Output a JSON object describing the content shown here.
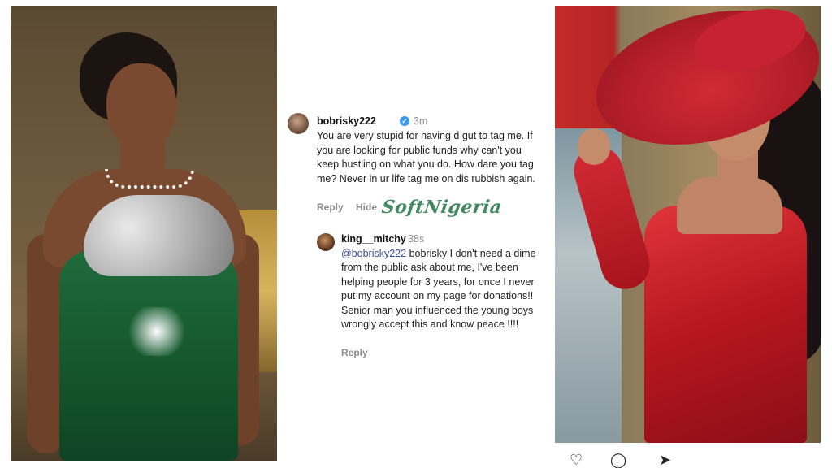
{
  "comment": {
    "username": "bobrisky222",
    "time": "3m",
    "text": "You are very stupid for having d gut to tag me. If you are looking for public funds why can't you keep hustling on what you do. How dare you tag me? Never in ur life tag me on dis rubbish again.",
    "reply_label": "Reply",
    "hide_label": "Hide"
  },
  "watermark": "SoftNigeria",
  "reply": {
    "username": "king__mitchy",
    "time": "38s",
    "mention": "@bobrisky222",
    "text": " bobrisky I don't need a dime from the public ask about me, I've been helping people for 3 years, for once I never put my account on my page for donations!! Senior man you influenced the young boys wrongly accept this and know peace !!!!",
    "reply_label": "Reply"
  },
  "action_icons": [
    "heart-icon",
    "comment-icon",
    "share-icon"
  ]
}
